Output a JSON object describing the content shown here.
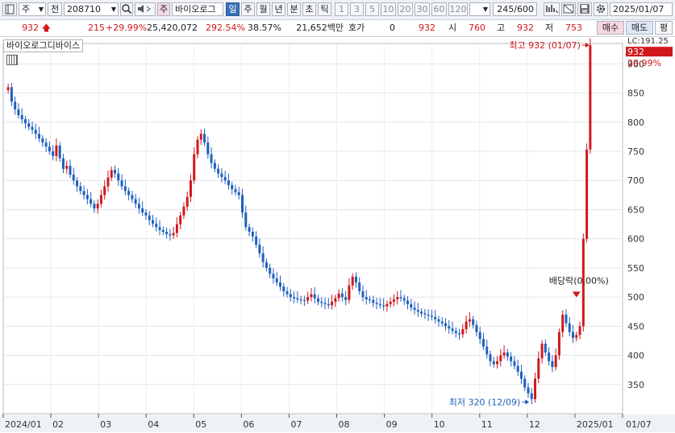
{
  "toolbar": {
    "market": "주",
    "prefix": "전",
    "code": "208710",
    "name_tag": "주",
    "name": "바이오로그",
    "periods": [
      "일",
      "주",
      "월",
      "년",
      "분",
      "초",
      "틱"
    ],
    "active_period": "일",
    "intervals": [
      "1",
      "3",
      "5",
      "10",
      "20",
      "30",
      "60",
      "120"
    ],
    "count": "245",
    "count_max": "/600",
    "date": "2025/01/07"
  },
  "quote": {
    "price": "932",
    "change": "215",
    "change_pct": "+29.99%",
    "volume": "25,420,072",
    "volume_ratio": "292.54%",
    "turnover": "38.57%",
    "amount": "21,652백만",
    "hoga_label": "호가",
    "hoga_value": "0",
    "bid": "932",
    "open_label": "시",
    "open": "760",
    "high_label": "고",
    "high": "932",
    "low_label": "저",
    "low": "753",
    "buy_button": "매수",
    "sell_button": "매도",
    "eval_button": "평"
  },
  "colors": {
    "up": "#d0181b",
    "down": "#1f5fbf",
    "accent": "#3b6fb5"
  },
  "icons": [
    "dropdown-icon",
    "search-icon",
    "speaker-icon",
    "chart-settings-icon",
    "save-icon",
    "print-icon",
    "gear-icon",
    "grid-icon"
  ],
  "chart_data": {
    "type": "candlestick",
    "title": "바이오로그디바이스",
    "ylim": [
      300,
      935
    ],
    "yticks": [
      350,
      400,
      450,
      500,
      550,
      600,
      650,
      700,
      750,
      800,
      850,
      900
    ],
    "x_labels": [
      "2024/01",
      "02",
      "03",
      "04",
      "05",
      "06",
      "07",
      "08",
      "09",
      "10",
      "11",
      "12",
      "2025/01",
      "01/07"
    ],
    "price_label": "932",
    "price_pct": "29.99%",
    "lc_label": "LC:191.25",
    "annotations": [
      {
        "text": "최고 932 (01/07)",
        "value": 932
      },
      {
        "text": "최저 320 (12/09)",
        "value": 320
      },
      {
        "text": "배당락(0.00%)",
        "value": 490
      }
    ],
    "series": [
      {
        "values": [
          860,
          835,
          822,
          812,
          805,
          798,
          792,
          787,
          780,
          772,
          765,
          758,
          750,
          742,
          760,
          738,
          720,
          725,
          710,
          700,
          690,
          682,
          675,
          668,
          660,
          652,
          660,
          675,
          690,
          705,
          718,
          712,
          700,
          690,
          682,
          675,
          668,
          660,
          652,
          645,
          640,
          632,
          626,
          620,
          615,
          612,
          608,
          606,
          610,
          625,
          640,
          655,
          672,
          700,
          745,
          770,
          780,
          765,
          745,
          730,
          720,
          712,
          706,
          700,
          692,
          685,
          680,
          675,
          645,
          620,
          612,
          604,
          590,
          575,
          560,
          550,
          540,
          532,
          525,
          518,
          510,
          505,
          500,
          498,
          496,
          495,
          494,
          500,
          505,
          498,
          492,
          490,
          488,
          486,
          492,
          498,
          506,
          500,
          495,
          520,
          535,
          525,
          510,
          500,
          496,
          495,
          490,
          488,
          486,
          484,
          488,
          492,
          496,
          500,
          498,
          494,
          488,
          482,
          478,
          475,
          472,
          470,
          468,
          466,
          462,
          458,
          455,
          450,
          446,
          442,
          438,
          436,
          445,
          458,
          462,
          452,
          440,
          428,
          415,
          402,
          390,
          385,
          390,
          400,
          405,
          398,
          390,
          382,
          372,
          360,
          345,
          335,
          325,
          360,
          395,
          420,
          405,
          390,
          380,
          400,
          440,
          470,
          455,
          440,
          430,
          435,
          450,
          600,
          753,
          932
        ]
      }
    ]
  }
}
